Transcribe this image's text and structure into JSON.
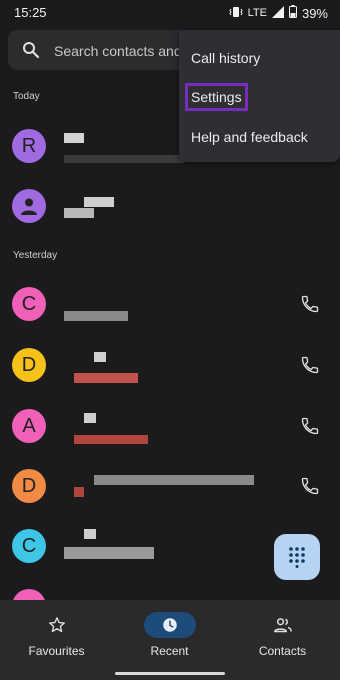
{
  "status": {
    "time": "15:25",
    "network": "LTE",
    "battery": "39%"
  },
  "search": {
    "placeholder": "Search contacts and places"
  },
  "sections": {
    "today": "Today",
    "yesterday": "Yesterday"
  },
  "rows": [
    {
      "letter": "R",
      "color": "#a06be0"
    },
    {
      "letter": "",
      "color": "#a06be0",
      "icon": "person-icon"
    },
    {
      "letter": "C",
      "color": "#f060b8"
    },
    {
      "letter": "D",
      "color": "#f6c21a"
    },
    {
      "letter": "A",
      "color": "#f060b8"
    },
    {
      "letter": "D",
      "color": "#f08a45"
    },
    {
      "letter": "C",
      "color": "#3ec6e6"
    },
    {
      "letter": "",
      "color": "#f060b8"
    }
  ],
  "menu": {
    "call_history": "Call history",
    "settings": "Settings",
    "help": "Help and feedback"
  },
  "nav": {
    "favourites": "Favourites",
    "recent": "Recent",
    "contacts": "Contacts"
  },
  "colors": {
    "background": "#1b1b1d",
    "menu": "#2e2f33",
    "highlight": "#7a2dbd",
    "fab": "#b5d3f2",
    "recent_pill": "#1e4c7a"
  },
  "icons": [
    "search-icon",
    "phone-icon",
    "dialpad-icon",
    "star-icon",
    "clock-icon",
    "contacts-icon"
  ]
}
